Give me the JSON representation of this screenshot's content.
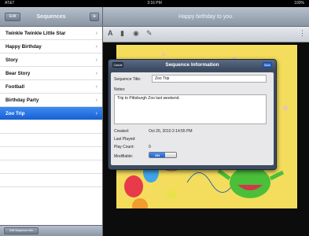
{
  "status": {
    "carrier": "AT&T",
    "time": "3:16 PM",
    "battery": "100%"
  },
  "left": {
    "title": "Sequences",
    "edit_label": "Edit",
    "add_label": "+",
    "items": [
      {
        "label": "Twinkle Twinkle Little Star"
      },
      {
        "label": "Happy Birthday"
      },
      {
        "label": "Story"
      },
      {
        "label": "Bear Story"
      },
      {
        "label": "Football"
      },
      {
        "label": "Birthday Party"
      },
      {
        "label": "Zoo Trip"
      }
    ],
    "bottom_button": "Edit Sequence Info"
  },
  "right": {
    "title": "Happy birthday to you."
  },
  "popover": {
    "title": "Sequence Information",
    "cancel_label": "Cancel",
    "save_label": "Save",
    "title_label": "Sequence Title:",
    "title_value": "Zoo Trip",
    "notes_label": "Notes:",
    "notes_value": "Trip to Pittsburgh Zoo last weekend.",
    "created_label": "Created:",
    "created_value": "Oct 26, 2010 2:14:55 PM",
    "last_played_label": "Last Played:",
    "last_played_value": "",
    "play_count_label": "Play Count:",
    "play_count_value": "0",
    "modifiable_label": "Modifiable:",
    "modifiable_value": "ON"
  }
}
